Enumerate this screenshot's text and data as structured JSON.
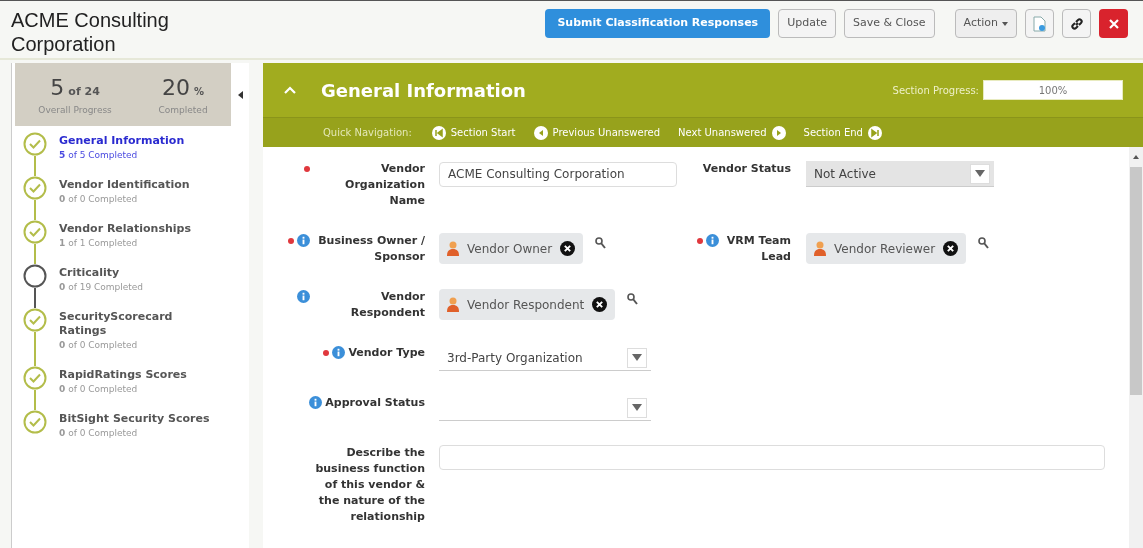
{
  "header": {
    "title": "ACME Consulting Corporation",
    "buttons": [
      {
        "label": "Submit Classification Responses",
        "kind": "primary"
      },
      {
        "label": "Update",
        "kind": "default"
      },
      {
        "label": "Save & Close",
        "kind": "default"
      },
      {
        "label": "Action",
        "kind": "menu"
      },
      {
        "kind": "document"
      },
      {
        "kind": "link"
      },
      {
        "kind": "close"
      }
    ]
  },
  "progress": {
    "count": "5",
    "count_suffix": "of 24",
    "count_label": "Overall Progress",
    "percent": "20",
    "percent_suffix": "%",
    "percent_label": "Completed"
  },
  "sections": [
    {
      "title": "General Information",
      "status": "**5** of 5 Completed",
      "complete": true,
      "selected": true
    },
    {
      "title": "Vendor Identification",
      "status": "**0** of 0 Completed",
      "complete": true,
      "selected": false
    },
    {
      "title": "Vendor Relationships",
      "status": "**1** of 1 Completed",
      "complete": true,
      "selected": false
    },
    {
      "title": "Criticality",
      "status": "**0** of 19 Completed",
      "complete": false,
      "selected": false
    },
    {
      "title": "SecurityScorecard Ratings",
      "status": "**0** of 0 Completed",
      "complete": true,
      "selected": false
    },
    {
      "title": "RapidRatings Scores",
      "status": "**0** of 0 Completed",
      "complete": true,
      "selected": false
    },
    {
      "title": "BitSight Security Scores",
      "status": "**0** of 0 Completed",
      "complete": true,
      "selected": false
    }
  ],
  "section": {
    "title": "General Information",
    "expanded": true,
    "progress_label": "Section Progress:",
    "progress_text": "100%",
    "level": 1,
    "quick_nav_label": "Quick Navigation:",
    "nav": [
      {
        "label": "Section Start",
        "kind": "start"
      },
      {
        "label": "Previous Unanswered",
        "kind": "prev"
      },
      {
        "label": "Next Unanswered",
        "kind": "next"
      },
      {
        "label": "Section End",
        "kind": "end"
      }
    ]
  },
  "rows": [
    [
      {
        "label": "Vendor Organization Name",
        "required": true,
        "info": false,
        "kind": "text",
        "value": "ACME Consulting Corporation"
      },
      {
        "label": "Vendor Status",
        "required": false,
        "info": false,
        "kind": "select",
        "value": "Not Active",
        "disabled": true
      }
    ],
    [
      {
        "label": "Business Owner / Sponsor",
        "required": true,
        "info": true,
        "kind": "person",
        "value": "Vendor Owner"
      },
      {
        "label": "VRM Team Lead",
        "required": true,
        "info": true,
        "kind": "person",
        "value": "Vendor Reviewer"
      }
    ],
    [
      {
        "label": "Vendor Respondent",
        "required": false,
        "info": true,
        "kind": "person",
        "value": "Vendor Respondent"
      }
    ],
    [
      {
        "label": "Vendor Type",
        "required": true,
        "info": true,
        "kind": "select",
        "value": "3rd-Party Organization",
        "disabled": false
      }
    ],
    [
      {
        "label": "Approval Status",
        "required": false,
        "info": true,
        "kind": "select",
        "disabled": false
      }
    ],
    [
      {
        "label": "Describe the business function of this vendor & the nature of the relationship",
        "required": false,
        "info": false,
        "kind": "textarea"
      }
    ]
  ]
}
